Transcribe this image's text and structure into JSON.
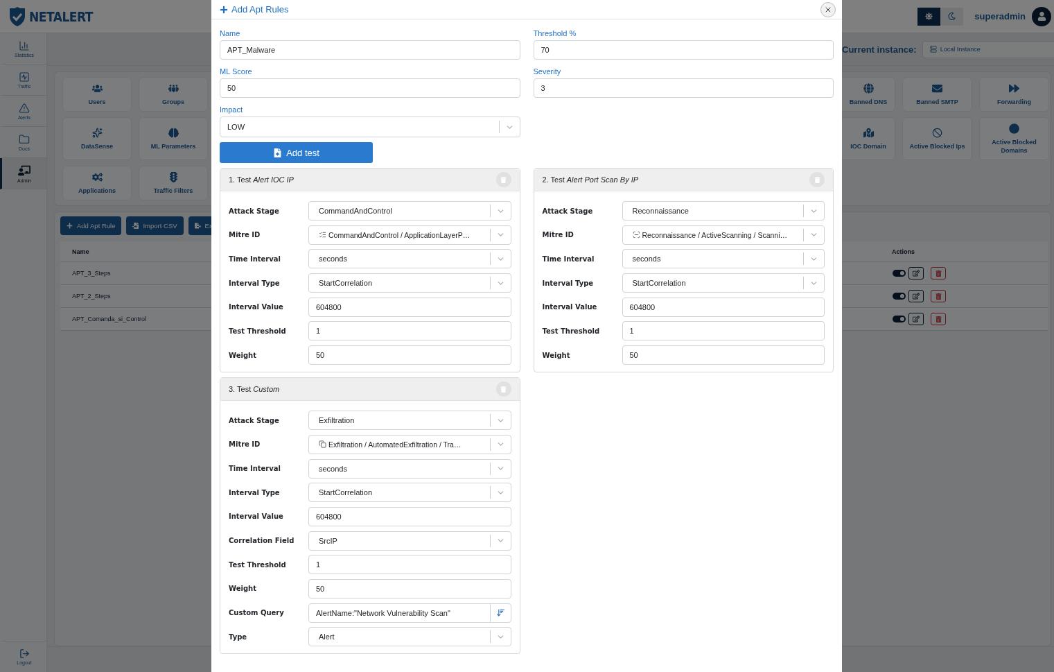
{
  "brand": {
    "name": "NETALERT"
  },
  "sidebar": {
    "items": [
      {
        "label": "Statistics",
        "selected": false
      },
      {
        "label": "Traffic",
        "selected": false
      },
      {
        "label": "Alerts",
        "selected": false
      },
      {
        "label": "Docs",
        "selected": false
      },
      {
        "label": "Admin",
        "selected": true
      }
    ],
    "footer": "Logout"
  },
  "header": {
    "theme": [
      {
        "kind": "light",
        "selected": true
      },
      {
        "kind": "dark",
        "selected": false
      }
    ],
    "user": "superadmin"
  },
  "instance": {
    "label": "Current instance:",
    "value": "Local Instance"
  },
  "tiles_left": [
    "Users",
    "Groups",
    "DataSense",
    "ML Parameters",
    "Applications",
    "Traffic Filters"
  ],
  "tiles_right": [
    "Banned DNS",
    "Banned SMTP",
    "Forwarding",
    "IOC Domain",
    "Active Blocked Ips",
    "Active Blocked Domains"
  ],
  "toolbar": [
    "Add Apt Rule",
    "Import CSV",
    "Ex"
  ],
  "table": {
    "columns": [
      "Name",
      "Actions"
    ],
    "rows": [
      {
        "name": "APT_3_Steps",
        "on": true
      },
      {
        "name": "APT_2_Steps",
        "on": true
      },
      {
        "name": "APT_Comanda_si_Control",
        "on": true
      }
    ]
  },
  "modal": {
    "title": "Add Apt Rules",
    "fields": [
      {
        "label": "Name",
        "kind": "input",
        "value": "APT_Malware"
      },
      {
        "label": "Threshold %",
        "kind": "input",
        "value": "70"
      },
      {
        "label": "ML Score",
        "kind": "input",
        "value": "50"
      },
      {
        "label": "Severity",
        "kind": "input",
        "value": "3"
      },
      {
        "label": "Impact",
        "kind": "select",
        "value": "LOW"
      }
    ],
    "add_button": "Add test",
    "tests": [
      {
        "title": "1. Test *Alert IOC IP*",
        "rows": [
          {
            "label": "Attack Stage",
            "kind": "select",
            "value": "CommandAndControl"
          },
          {
            "label": "Mitre ID",
            "kind": "mitre",
            "value": "CommandAndControl / ApplicationLayerP…"
          },
          {
            "label": "Time Interval",
            "kind": "select",
            "value": "seconds"
          },
          {
            "label": "Interval Type",
            "kind": "select",
            "value": "StartCorrelation"
          },
          {
            "label": "Interval Value",
            "kind": "input",
            "value": "604800"
          },
          {
            "label": "Test Threshold",
            "kind": "input",
            "value": "1"
          },
          {
            "label": "Weight",
            "kind": "input",
            "value": "50"
          }
        ]
      },
      {
        "title": "2. Test *Alert Port Scan By IP*",
        "rows": [
          {
            "label": "Attack Stage",
            "kind": "select",
            "value": "Reconnaissance"
          },
          {
            "label": "Mitre ID",
            "kind": "mitre",
            "value": "Reconnaissance / ActiveScanning / Scanni…"
          },
          {
            "label": "Time Interval",
            "kind": "select",
            "value": "seconds"
          },
          {
            "label": "Interval Type",
            "kind": "select",
            "value": "StartCorrelation"
          },
          {
            "label": "Interval Value",
            "kind": "input",
            "value": "604800"
          },
          {
            "label": "Test Threshold",
            "kind": "input",
            "value": "1"
          },
          {
            "label": "Weight",
            "kind": "input",
            "value": "50"
          }
        ]
      },
      {
        "title": "3. Test *Custom*",
        "rows": [
          {
            "label": "Attack Stage",
            "kind": "select",
            "value": "Exfiltration"
          },
          {
            "label": "Mitre ID",
            "kind": "mitre",
            "value": "Exfiltration / AutomatedExfiltration / Tra…"
          },
          {
            "label": "Time Interval",
            "kind": "select",
            "value": "seconds"
          },
          {
            "label": "Interval Type",
            "kind": "select",
            "value": "StartCorrelation"
          },
          {
            "label": "Interval Value",
            "kind": "input",
            "value": "604800"
          },
          {
            "label": "Correlation Field",
            "kind": "select",
            "value": "SrcIP"
          },
          {
            "label": "Test Threshold",
            "kind": "input",
            "value": "1"
          },
          {
            "label": "Weight",
            "kind": "input",
            "value": "50"
          },
          {
            "label": "Custom Query",
            "kind": "query",
            "value": "AlertName:\"Network Vulnerability Scan\""
          },
          {
            "label": "Type",
            "kind": "select",
            "value": "Alert"
          }
        ]
      }
    ]
  }
}
